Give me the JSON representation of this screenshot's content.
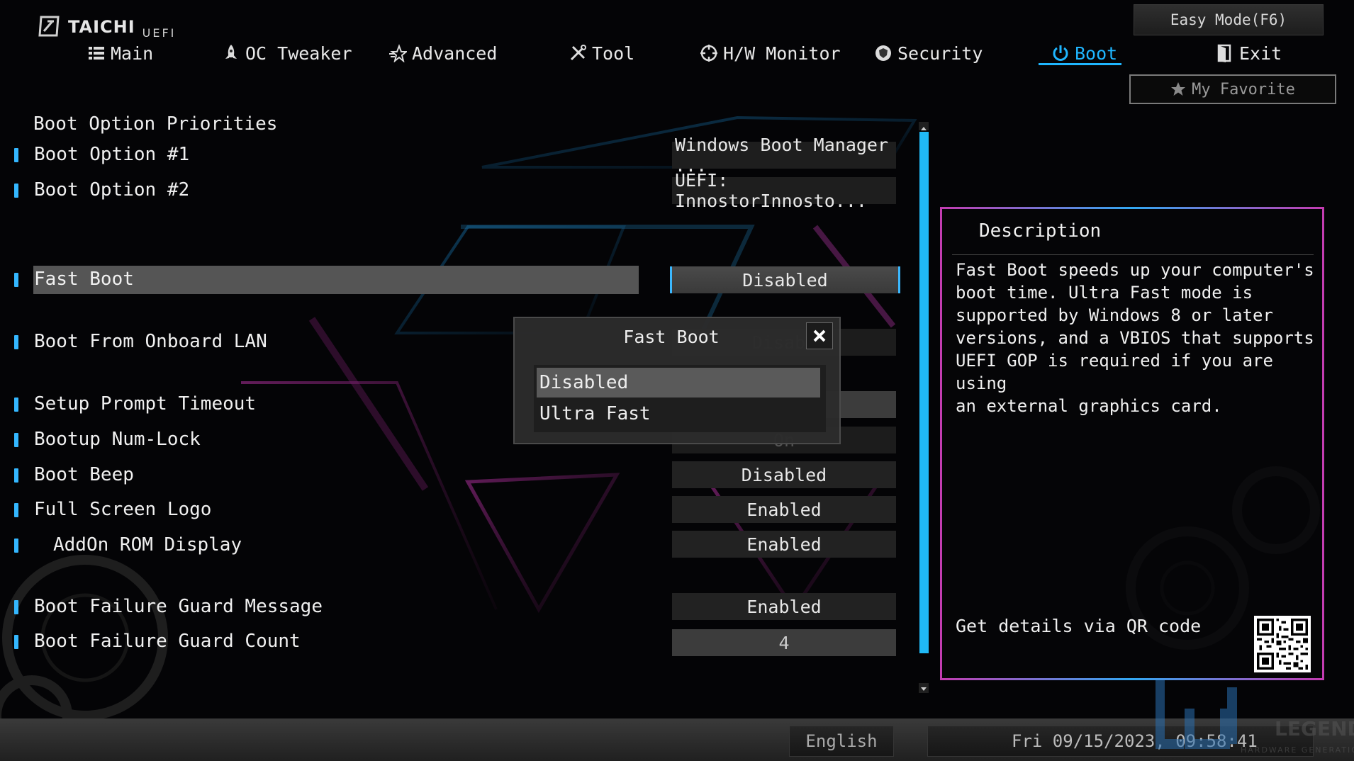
{
  "brand": {
    "name": "TAICHI",
    "sub": "UEFI"
  },
  "easy_mode": "Easy Mode(F6)",
  "my_favorite": "My Favorite",
  "nav": [
    {
      "label": "Main",
      "icon": "list-icon"
    },
    {
      "label": "OC Tweaker",
      "icon": "rocket-icon"
    },
    {
      "label": "Advanced",
      "icon": "star-icon"
    },
    {
      "label": "Tool",
      "icon": "tools-icon"
    },
    {
      "label": "H/W Monitor",
      "icon": "crosshair-icon"
    },
    {
      "label": "Security",
      "icon": "shield-icon"
    },
    {
      "label": "Boot",
      "icon": "power-icon",
      "active": true
    },
    {
      "label": "Exit",
      "icon": "door-icon"
    }
  ],
  "section_title": "Boot Option Priorities",
  "settings": [
    {
      "label": "Boot Option #1",
      "value": "Windows Boot Manager ..."
    },
    {
      "label": "Boot Option #2",
      "value": "UEFI: InnostorInnosto..."
    },
    {
      "label": "Fast Boot",
      "value": "Disabled"
    },
    {
      "label": "Boot From Onboard LAN",
      "value": "Disabl"
    },
    {
      "label": "Setup Prompt Timeout",
      "value": ""
    },
    {
      "label": "Bootup Num-Lock",
      "value": "On"
    },
    {
      "label": "Boot Beep",
      "value": "Disabled"
    },
    {
      "label": "Full Screen Logo",
      "value": "Enabled"
    },
    {
      "label": "AddOn ROM Display",
      "value": "Enabled"
    },
    {
      "label": "Boot Failure Guard Message",
      "value": "Enabled"
    },
    {
      "label": "Boot Failure Guard Count",
      "value": "4"
    }
  ],
  "popup": {
    "title": "Fast Boot",
    "options": [
      "Disabled",
      "Ultra Fast"
    ],
    "highlighted": "Disabled"
  },
  "description": {
    "title": "Description",
    "text": "Fast Boot speeds up your computer's\nboot time. Ultra Fast mode is\nsupported by Windows 8 or later\nversions, and a VBIOS that supports\nUEFI GOP is required if you are using\nan external graphics card.",
    "qr_label": "Get details via QR code"
  },
  "footer": {
    "language": "English",
    "datetime": "Fri 09/15/2023, 09:58:41"
  },
  "watermark": {
    "text": "LEGEND",
    "sub": "HARDWARE GENERATION"
  },
  "colors": {
    "accent": "#1fb6ff",
    "panel_pink": "#c33cb1",
    "panel_blue": "#32a8f2"
  }
}
